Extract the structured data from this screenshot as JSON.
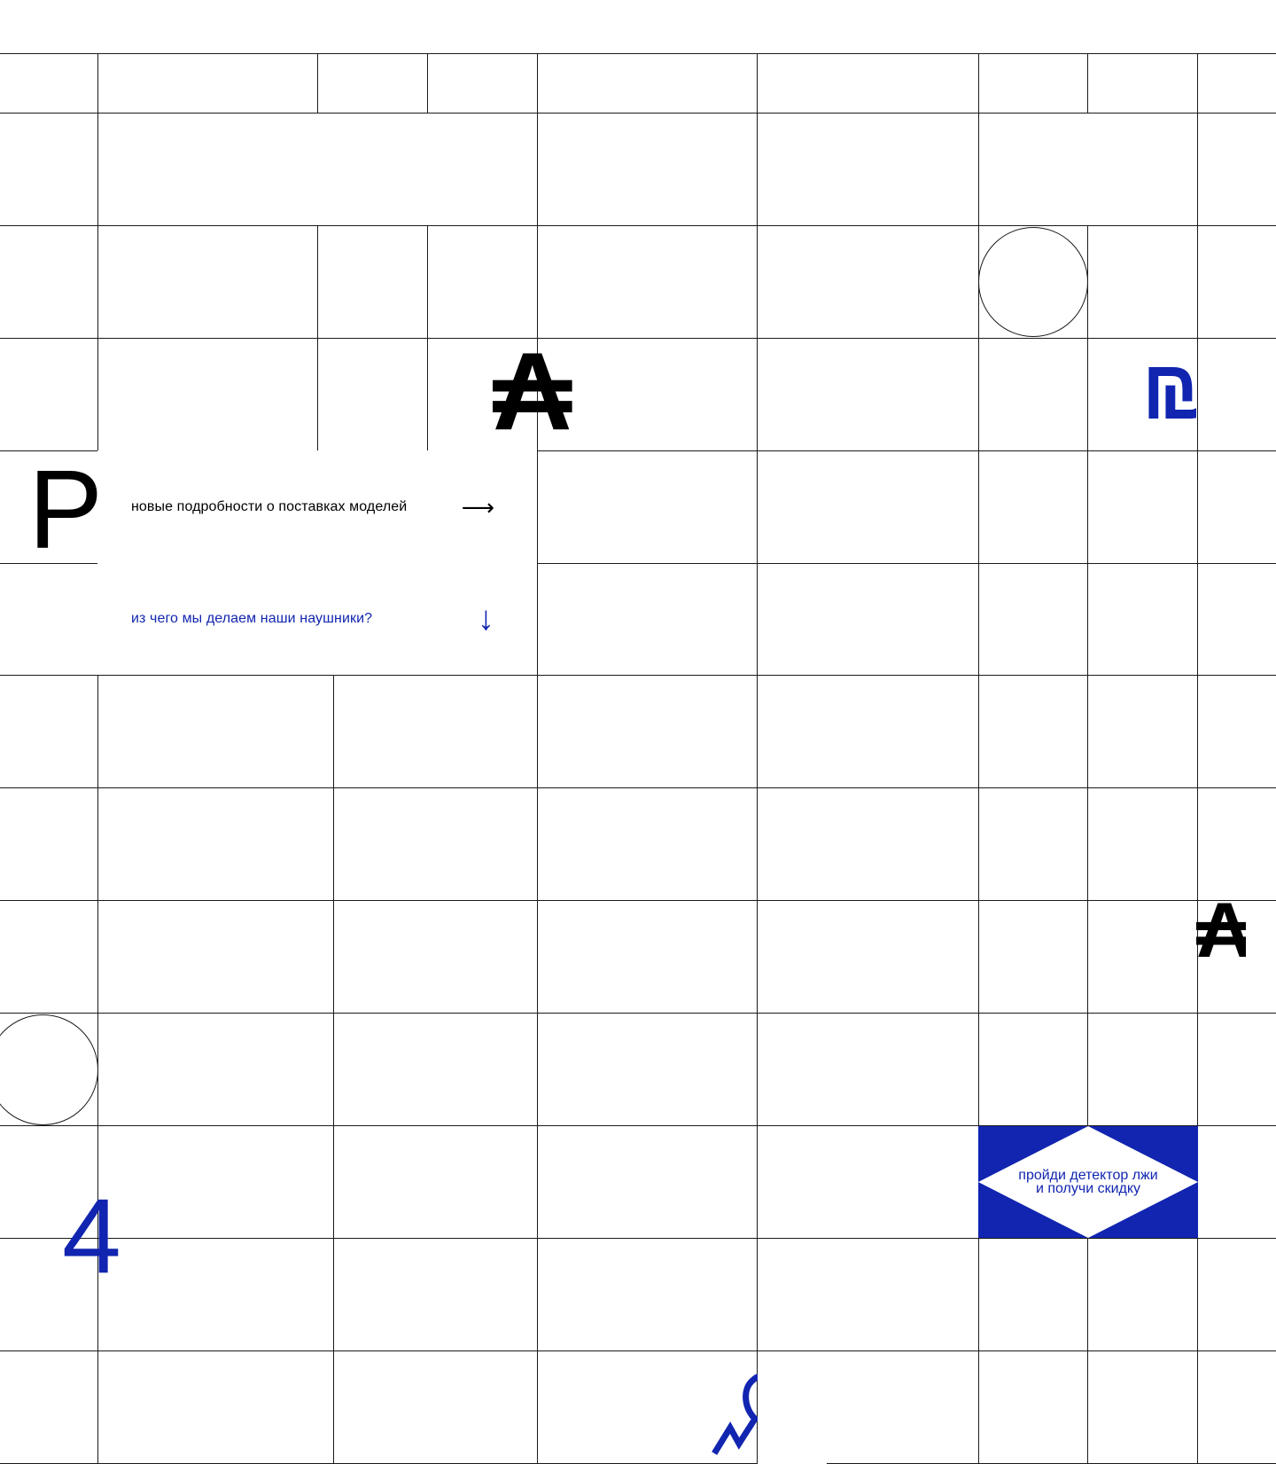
{
  "colors": {
    "accent": "#1125b0",
    "ink": "#000000",
    "grid": "#1a1a1a",
    "background": "#ffffff"
  },
  "decor": {
    "glyph_hryvnia_top": "₳",
    "glyph_ruble_left": "Р",
    "glyph_shekel": "₪",
    "glyph_hryvnia_right": "₳",
    "glyph_four": "4"
  },
  "links": [
    {
      "label": "новые подробности о поставках моделей",
      "icon": "arrow-right-icon",
      "arrow": "⟶"
    },
    {
      "label": "из чего мы делаем наши наушники?",
      "icon": "arrow-down-icon",
      "arrow": "↓"
    }
  ],
  "promo": {
    "line1": "пройди детектор лжи",
    "line2": "и получи скидку"
  }
}
